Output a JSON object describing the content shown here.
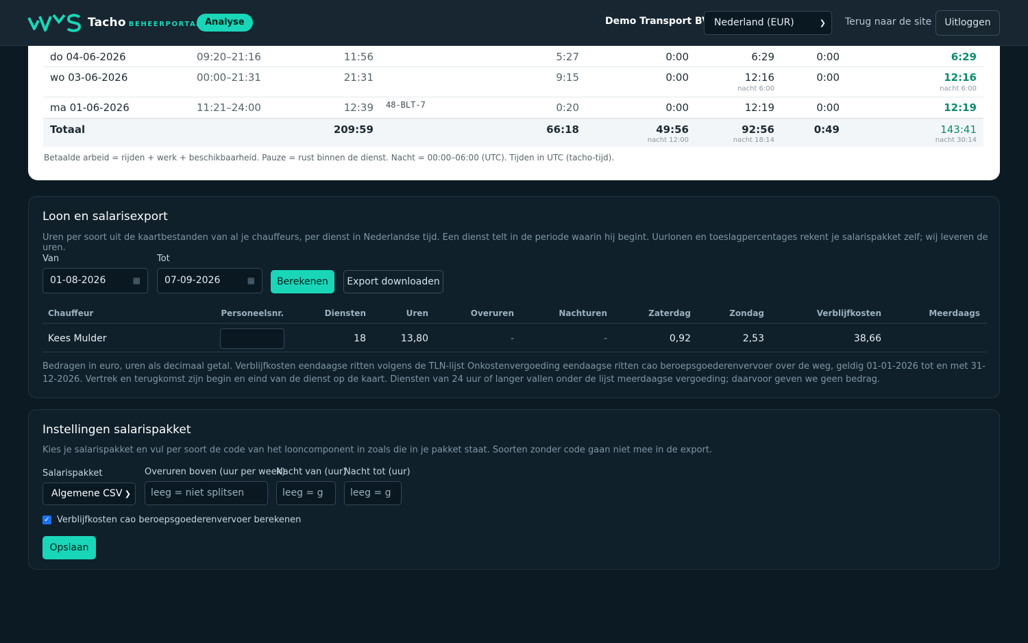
{
  "header": {
    "brand": "Tacho",
    "brand_sub": "BEHEERPORTAAL",
    "badge": "Analyse",
    "company": "Demo Transport BV",
    "region": "Nederland (EUR)",
    "back_link": "Terug naar de site",
    "logout": "Uitloggen"
  },
  "shifts": {
    "rows": [
      {
        "date": "do 04-06-2026",
        "time": "09:20–21:16",
        "duration": "11:56",
        "plate": "",
        "driving": "5:27",
        "work": "0:00",
        "paid": "6:29",
        "paid_night": "",
        "pause": "0:00",
        "total": "6:29",
        "total_night": ""
      },
      {
        "date": "wo 03-06-2026",
        "time": "00:00–21:31",
        "duration": "21:31",
        "plate": "",
        "driving": "9:15",
        "work": "0:00",
        "paid": "12:16",
        "paid_night": "nacht 6:00",
        "pause": "0:00",
        "total": "12:16",
        "total_night": "nacht 6:00"
      },
      {
        "date": "ma 01-06-2026",
        "time": "11:21–24:00",
        "duration": "12:39",
        "plate": "48-BLT-7",
        "driving": "0:20",
        "work": "0:00",
        "paid": "12:19",
        "paid_night": "",
        "pause": "0:00",
        "total": "12:19",
        "total_night": ""
      }
    ],
    "total": {
      "label": "Totaal",
      "duration": "209:59",
      "driving": "66:18",
      "work": "49:56",
      "work_night": "nacht 12:00",
      "paid": "92:56",
      "paid_night": "nacht 18:14",
      "pause": "0:49",
      "total": "143:41",
      "total_night": "nacht 30:14"
    },
    "footnote": "Betaalde arbeid = rijden + werk + beschikbaarheid. Pauze = rust binnen de dienst. Nacht = 00:00–06:00 (UTC). Tijden in UTC (tacho-tijd)."
  },
  "payroll": {
    "title": "Loon en salarisexport",
    "description": "Uren per soort uit de kaartbestanden van al je chauffeurs, per dienst in Nederlandse tijd. Een dienst telt in de periode waarin hij begint. Uurlonen en toeslagpercentages rekent je salarispakket zelf; wij leveren de uren.",
    "from_label": "Van",
    "from_value": "01-08-2026",
    "to_label": "Tot",
    "to_value": "07-09-2026",
    "calculate": "Berekenen",
    "export": "Export downloaden",
    "columns": [
      "Chauffeur",
      "Personeelsnr.",
      "Diensten",
      "Uren",
      "Overuren",
      "Nachturen",
      "Zaterdag",
      "Zondag",
      "Verblijfkosten",
      "Meerdaags"
    ],
    "row": {
      "driver": "Kees Mulder",
      "shifts": "18",
      "hours": "13,80",
      "overtime": "-",
      "night": "-",
      "saturday": "0,92",
      "sunday": "2,53",
      "allowance": "38,66"
    },
    "note": "Bedragen in euro, uren als decimaal getal. Verblijfkosten eendaagse ritten volgens de TLN-lijst Onkostenvergoeding eendaagse ritten cao beroepsgoederenvervoer over de weg, geldig 01-01-2026 tot en met 31-12-2026. Vertrek en terugkomst zijn begin en eind van de dienst op de kaart. Diensten van 24 uur of langer vallen onder de lijst meerdaagse vergoeding; daarvoor geven we geen bedrag."
  },
  "settings": {
    "title": "Instellingen salarispakket",
    "description": "Kies je salarispakket en vul per soort de code van het looncomponent in zoals die in je pakket staat. Soorten zonder code gaan niet mee in de export.",
    "package_label": "Salarispakket",
    "package_value": "Algemene CSV",
    "overtime_label": "Overuren boven (uur per week)",
    "overtime_placeholder": "leeg = niet splitsen",
    "night_from_label": "Nacht van (uur)",
    "night_from_placeholder": "leeg = g",
    "night_to_label": "Nacht tot (uur)",
    "night_to_placeholder": "leeg = g",
    "checkbox_label": "Verblijfkosten cao beroepsgoederenvervoer berekenen",
    "save": "Opslaan"
  },
  "colors": {
    "accent": "#1ad6b8",
    "background": "#0c1a24",
    "positive": "#0c8a6f"
  }
}
